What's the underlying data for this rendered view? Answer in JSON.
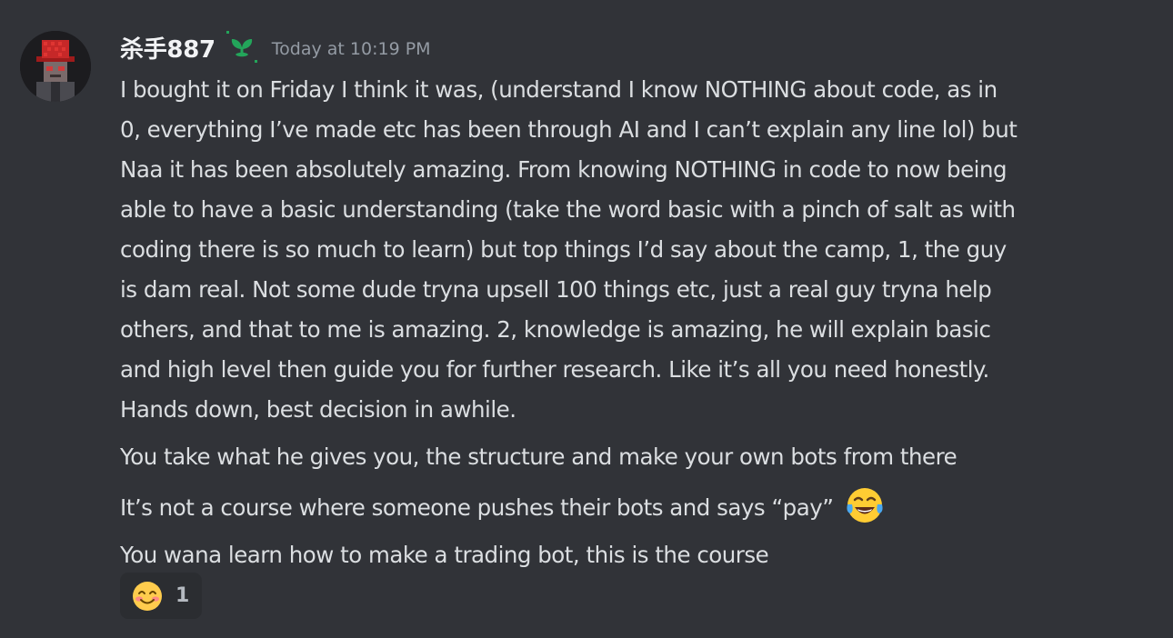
{
  "message": {
    "author": "杀手887",
    "timestamp": "Today at 10:19 PM",
    "avatar_icon": "red-hat-character-avatar",
    "role_icon": "seedling-icon",
    "body_lines": [
      "I bought it on Friday I think it was, (understand I know NOTHING about code, as in",
      "0, everything I’ve made etc has been through AI and I can’t explain any line lol) but",
      "Naa it has been absolutely amazing. From knowing NOTHING in code to now being",
      "able to have a basic understanding (take the word basic with a pinch of salt as with",
      "coding there is so much to learn) but top things I’d say about the camp, 1, the guy",
      "is dam real. Not some dude tryna upsell 100 things etc, just a real guy tryna help",
      "others, and that to me is amazing. 2, knowledge is amazing, he will explain basic",
      "and high level then guide you for further research. Like it’s all you need honestly.",
      "Hands down, best decision in awhile."
    ],
    "followups": [
      "You take what he gives you, the structure and make your own bots from there",
      "It’s not a course where someone pushes their bots and says “pay”",
      "You wana learn how to make a trading bot, this is the course"
    ],
    "inline_emoji": "tears-of-joy-emoji"
  },
  "reaction": {
    "emoji": "smiling-face-with-smiling-eyes-emoji",
    "count": "1"
  },
  "colors": {
    "background": "#313338",
    "text": "#dbdee1",
    "username": "#f2f3f5",
    "timestamp": "#949ba4",
    "role_green": "#23a55a",
    "reaction_bg": "#2b2d31"
  }
}
